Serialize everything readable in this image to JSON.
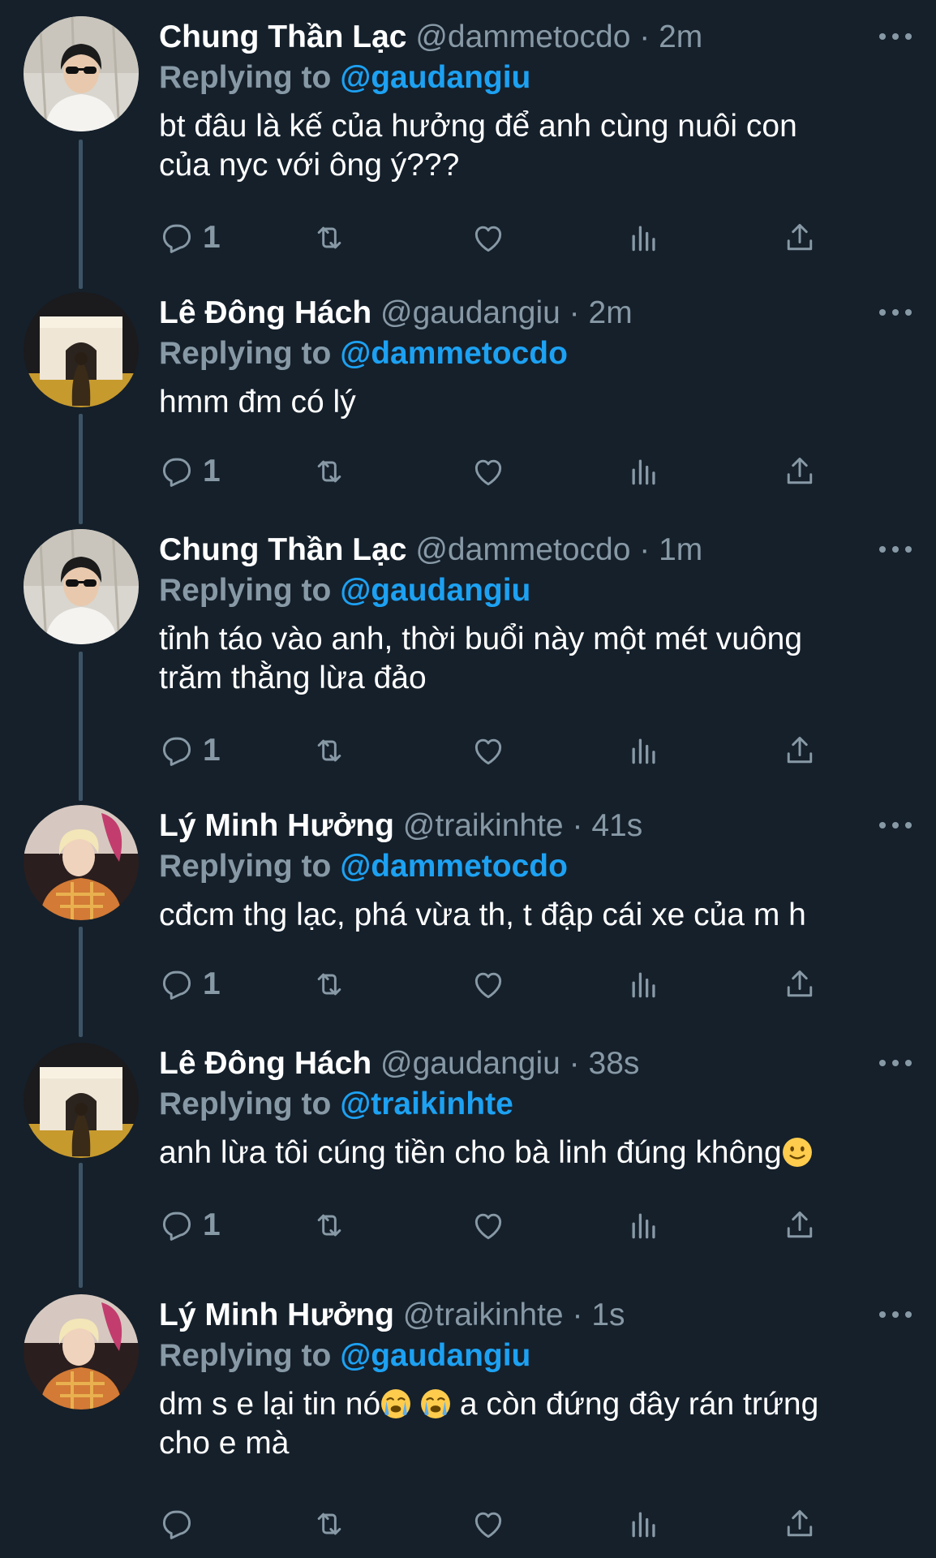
{
  "thread": {
    "replying_label": "Replying to",
    "tweets": [
      {
        "name": "Chung Thần Lạc",
        "handle": "@dammetocdo",
        "separator": "·",
        "time": "2m",
        "replying_to": "@gaudangiu",
        "text": "bt đâu là kế của hưởng để anh cùng nuôi con\ncủa nyc với ông ý???",
        "emoji_suffix": "",
        "reply_count": "1",
        "avatar": "avatar-boy-sunglasses"
      },
      {
        "name": "Lê Đông Hách",
        "handle": "@gaudangiu",
        "separator": "·",
        "time": "2m",
        "replying_to": "@dammetocdo",
        "text": "hmm đm có lý",
        "emoji_suffix": "",
        "reply_count": "1",
        "avatar": "avatar-arc-de-triomphe"
      },
      {
        "name": "Chung Thần Lạc",
        "handle": "@dammetocdo",
        "separator": "·",
        "time": "1m",
        "replying_to": "@gaudangiu",
        "text": "tỉnh táo vào anh, thời buổi này một mét vuông\ntrăm thằng lừa đảo",
        "emoji_suffix": "",
        "reply_count": "1",
        "avatar": "avatar-boy-sunglasses"
      },
      {
        "name": "Lý Minh Hưởng",
        "handle": "@traikinhte",
        "separator": "·",
        "time": "41s",
        "replying_to": "@dammetocdo",
        "text": "cđcm thg lạc, phá vừa th, t đập cái xe của m h",
        "emoji_suffix": "",
        "reply_count": "1",
        "avatar": "avatar-blond-jacket"
      },
      {
        "name": "Lê Đông Hách",
        "handle": "@gaudangiu",
        "separator": "·",
        "time": "38s",
        "replying_to": "@traikinhte",
        "text": "anh lừa tôi cúng tiền cho bà linh đúng không",
        "emoji_suffix": "slightly-smiling-emoji",
        "reply_count": "1",
        "avatar": "avatar-arc-de-triomphe"
      },
      {
        "name": "Lý Minh Hưởng",
        "handle": "@traikinhte",
        "separator": "·",
        "time": "1s",
        "replying_to": "@gaudangiu",
        "text_parts": [
          "dm s e lại tin nó",
          " ",
          "  a còn đứng đây rán trứng\ncho e mà"
        ],
        "emojis": [
          "crying-face-emoji",
          "crying-face-emoji"
        ],
        "reply_count": "",
        "avatar": "avatar-blond-jacket"
      }
    ]
  },
  "icons": {
    "reply": "reply-icon",
    "retweet": "retweet-icon",
    "like": "heart-icon",
    "analytics": "analytics-icon",
    "share": "share-icon",
    "more": "more-icon"
  },
  "colors": {
    "background": "#15202b",
    "primary_text": "#ffffff",
    "secondary_text": "#8899a6",
    "accent": "#1da1f2",
    "thread_line": "#3d5466"
  }
}
